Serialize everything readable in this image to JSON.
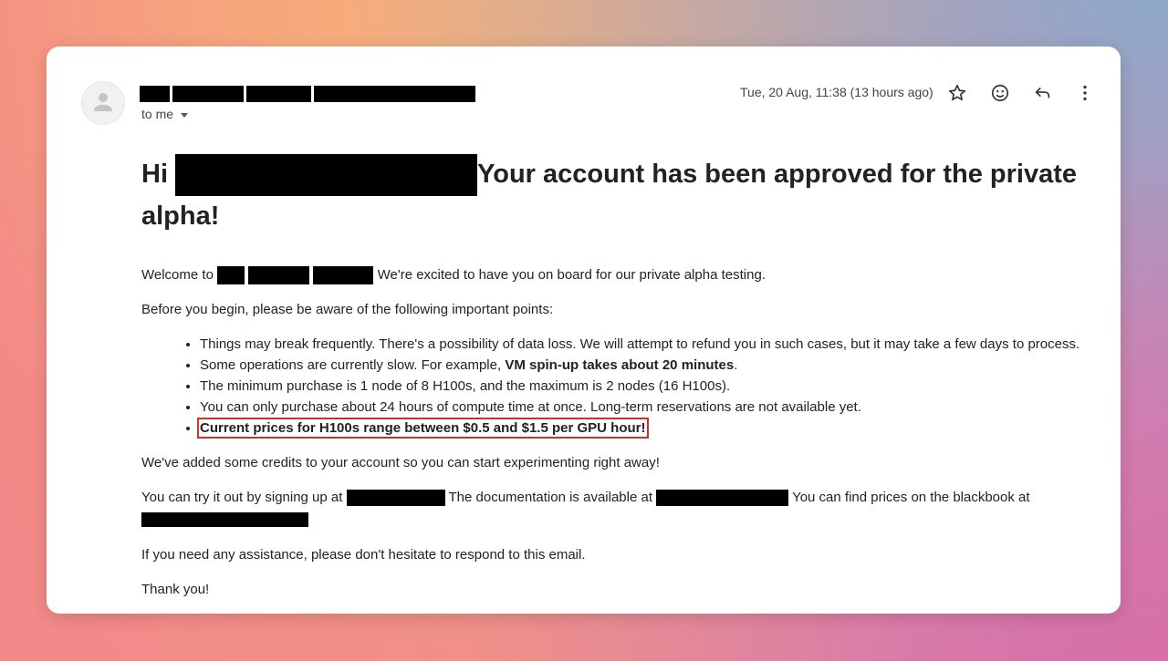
{
  "email": {
    "recipient_label": "to me",
    "timestamp": "Tue, 20 Aug, 11:38 (13 hours ago)",
    "actions": [
      "star-icon",
      "emoji-icon",
      "reply-icon",
      "more-vert-icon"
    ],
    "heading_start": "Hi",
    "heading_end": "Your account has been approved for the private alpha!",
    "welcome_start": "Welcome to",
    "welcome_end": "We're excited to have you on board for our private alpha testing.",
    "before": "Before you begin, please be aware of the following important points:",
    "points": [
      "Things may break frequently. There's a possibility of data loss. We will attempt to refund you in such cases, but it may take a few days to process.",
      "Some operations are currently slow. For example, ",
      "The minimum purchase is 1 node of 8 H100s, and the maximum is 2 nodes (16 H100s).",
      "You can only purchase about 24 hours of compute time at once. Long-term reservations are not available yet.",
      "Current prices for H100s range between $0.5 and $1.5 per GPU hour!"
    ],
    "point2_bold": "VM spin-up takes about 20 minutes",
    "point2_end": ".",
    "credits": "We've added some credits to your account so you can start experimenting right away!",
    "try_start": "You can try it out by signing up at",
    "try_docs": "The documentation is available at",
    "try_prices": "You can find prices on the blackbook at",
    "assist": "If you need any assistance, please don't hesitate to respond to this email.",
    "thanks": "Thank you!",
    "highlight_color": "#d0302a"
  }
}
